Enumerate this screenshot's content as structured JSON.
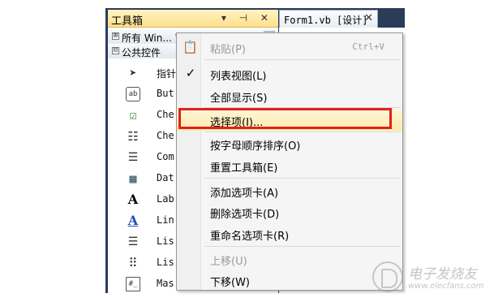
{
  "toolbox": {
    "title": "工具箱",
    "title_controls": "▾ ⊣ ✕",
    "groups": [
      {
        "expander": "⊞",
        "label": "所有 Win... 窗体"
      },
      {
        "expander": "⊟",
        "label": "公共控件"
      }
    ],
    "items": [
      {
        "icon": "pointer-icon",
        "glyph": "➤",
        "label": "指针"
      },
      {
        "icon": "button-icon",
        "glyph": "ab",
        "label": "But"
      },
      {
        "icon": "checkbox-icon",
        "glyph": "☑",
        "label": "Che"
      },
      {
        "icon": "checkedlistbox-icon",
        "glyph": "☷",
        "label": "Che"
      },
      {
        "icon": "combobox-icon",
        "glyph": "☰",
        "label": "Com"
      },
      {
        "icon": "datetimepicker-icon",
        "glyph": "▦",
        "label": "Dat"
      },
      {
        "icon": "label-icon",
        "glyph": "A",
        "label": "Lab"
      },
      {
        "icon": "linklabel-icon",
        "glyph": "A",
        "label": "Lin"
      },
      {
        "icon": "listbox-icon",
        "glyph": "☰",
        "label": "Lis"
      },
      {
        "icon": "listview-icon",
        "glyph": "⠿",
        "label": "Lis"
      },
      {
        "icon": "maskedtextbox-icon",
        "glyph": "#_",
        "label": "Mas"
      }
    ]
  },
  "document_tab": {
    "title": "Form1.vb [设计]",
    "close": "✕"
  },
  "context_menu": {
    "items": [
      {
        "label": "粘贴(P)",
        "shortcut": "Ctrl+V",
        "disabled": true,
        "icon": "paste-icon",
        "glyph": "📋",
        "checked": false
      },
      {
        "label": "列表视图(L)",
        "shortcut": "",
        "disabled": false,
        "checked": true,
        "check_glyph": "✓"
      },
      {
        "label": "全部显示(S)",
        "shortcut": "",
        "disabled": false,
        "checked": false
      },
      {
        "label": "选择项(I)...",
        "shortcut": "",
        "disabled": false,
        "checked": false,
        "hover": true
      },
      {
        "label": "按字母顺序排序(O)",
        "shortcut": "",
        "disabled": false,
        "checked": false
      },
      {
        "label": "重置工具箱(E)",
        "shortcut": "",
        "disabled": false,
        "checked": false
      },
      {
        "label": "添加选项卡(A)",
        "shortcut": "",
        "disabled": false,
        "checked": false
      },
      {
        "label": "删除选项卡(D)",
        "shortcut": "",
        "disabled": false,
        "checked": false
      },
      {
        "label": "重命名选项卡(R)",
        "shortcut": "",
        "disabled": false,
        "checked": false
      },
      {
        "label": "上移(U)",
        "shortcut": "",
        "disabled": true,
        "checked": false
      },
      {
        "label": "下移(W)",
        "shortcut": "",
        "disabled": false,
        "checked": false
      }
    ]
  },
  "watermark": {
    "brand": "电子发烧友",
    "url": "www.elecfans.com"
  },
  "colors": {
    "ide_background": "#2b3c59",
    "highlight_border": "#e0211b",
    "menu_background": "#f5f5f5"
  }
}
